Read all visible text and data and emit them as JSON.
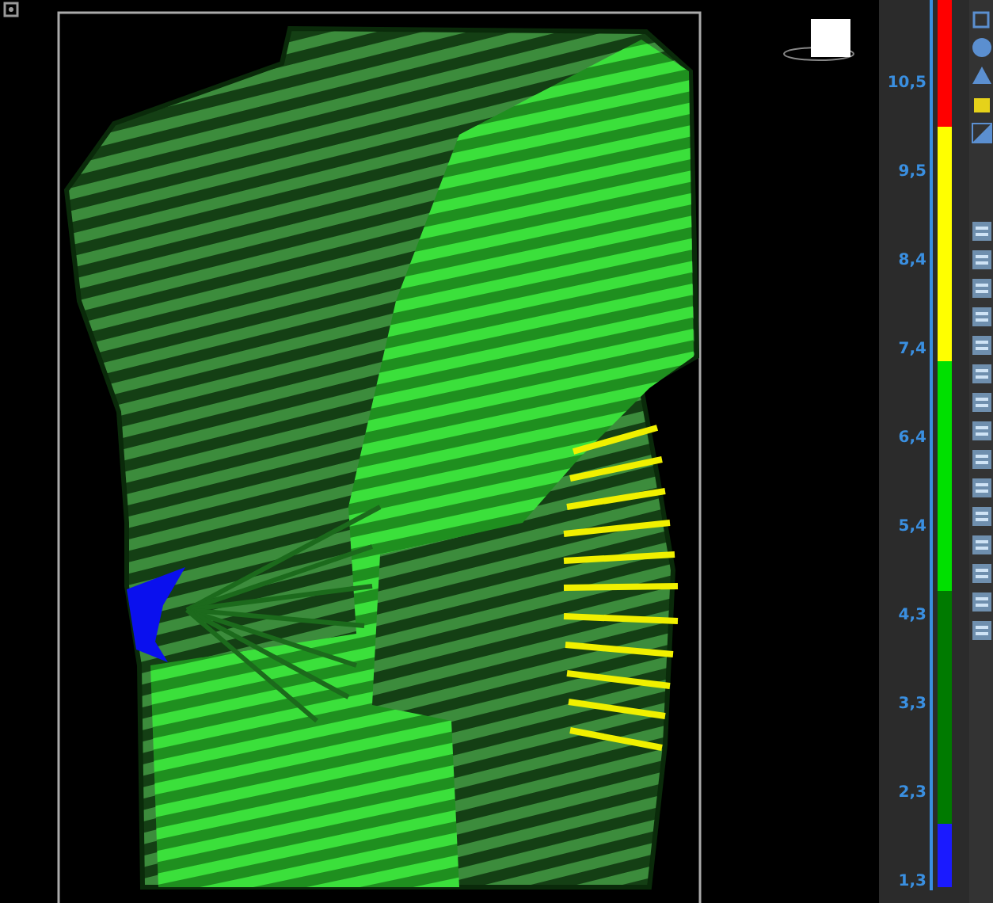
{
  "color_scale": {
    "ticks": [
      "10,5",
      "9,5",
      "8,4",
      "7,4",
      "6,4",
      "5,4",
      "4,3",
      "3,3",
      "2,3",
      "1,3"
    ],
    "bands": [
      {
        "color": "#ff0000"
      },
      {
        "color": "#ffff00"
      },
      {
        "color": "#00e000"
      },
      {
        "color": "#007a00"
      },
      {
        "color": "#1a1aff"
      }
    ]
  }
}
